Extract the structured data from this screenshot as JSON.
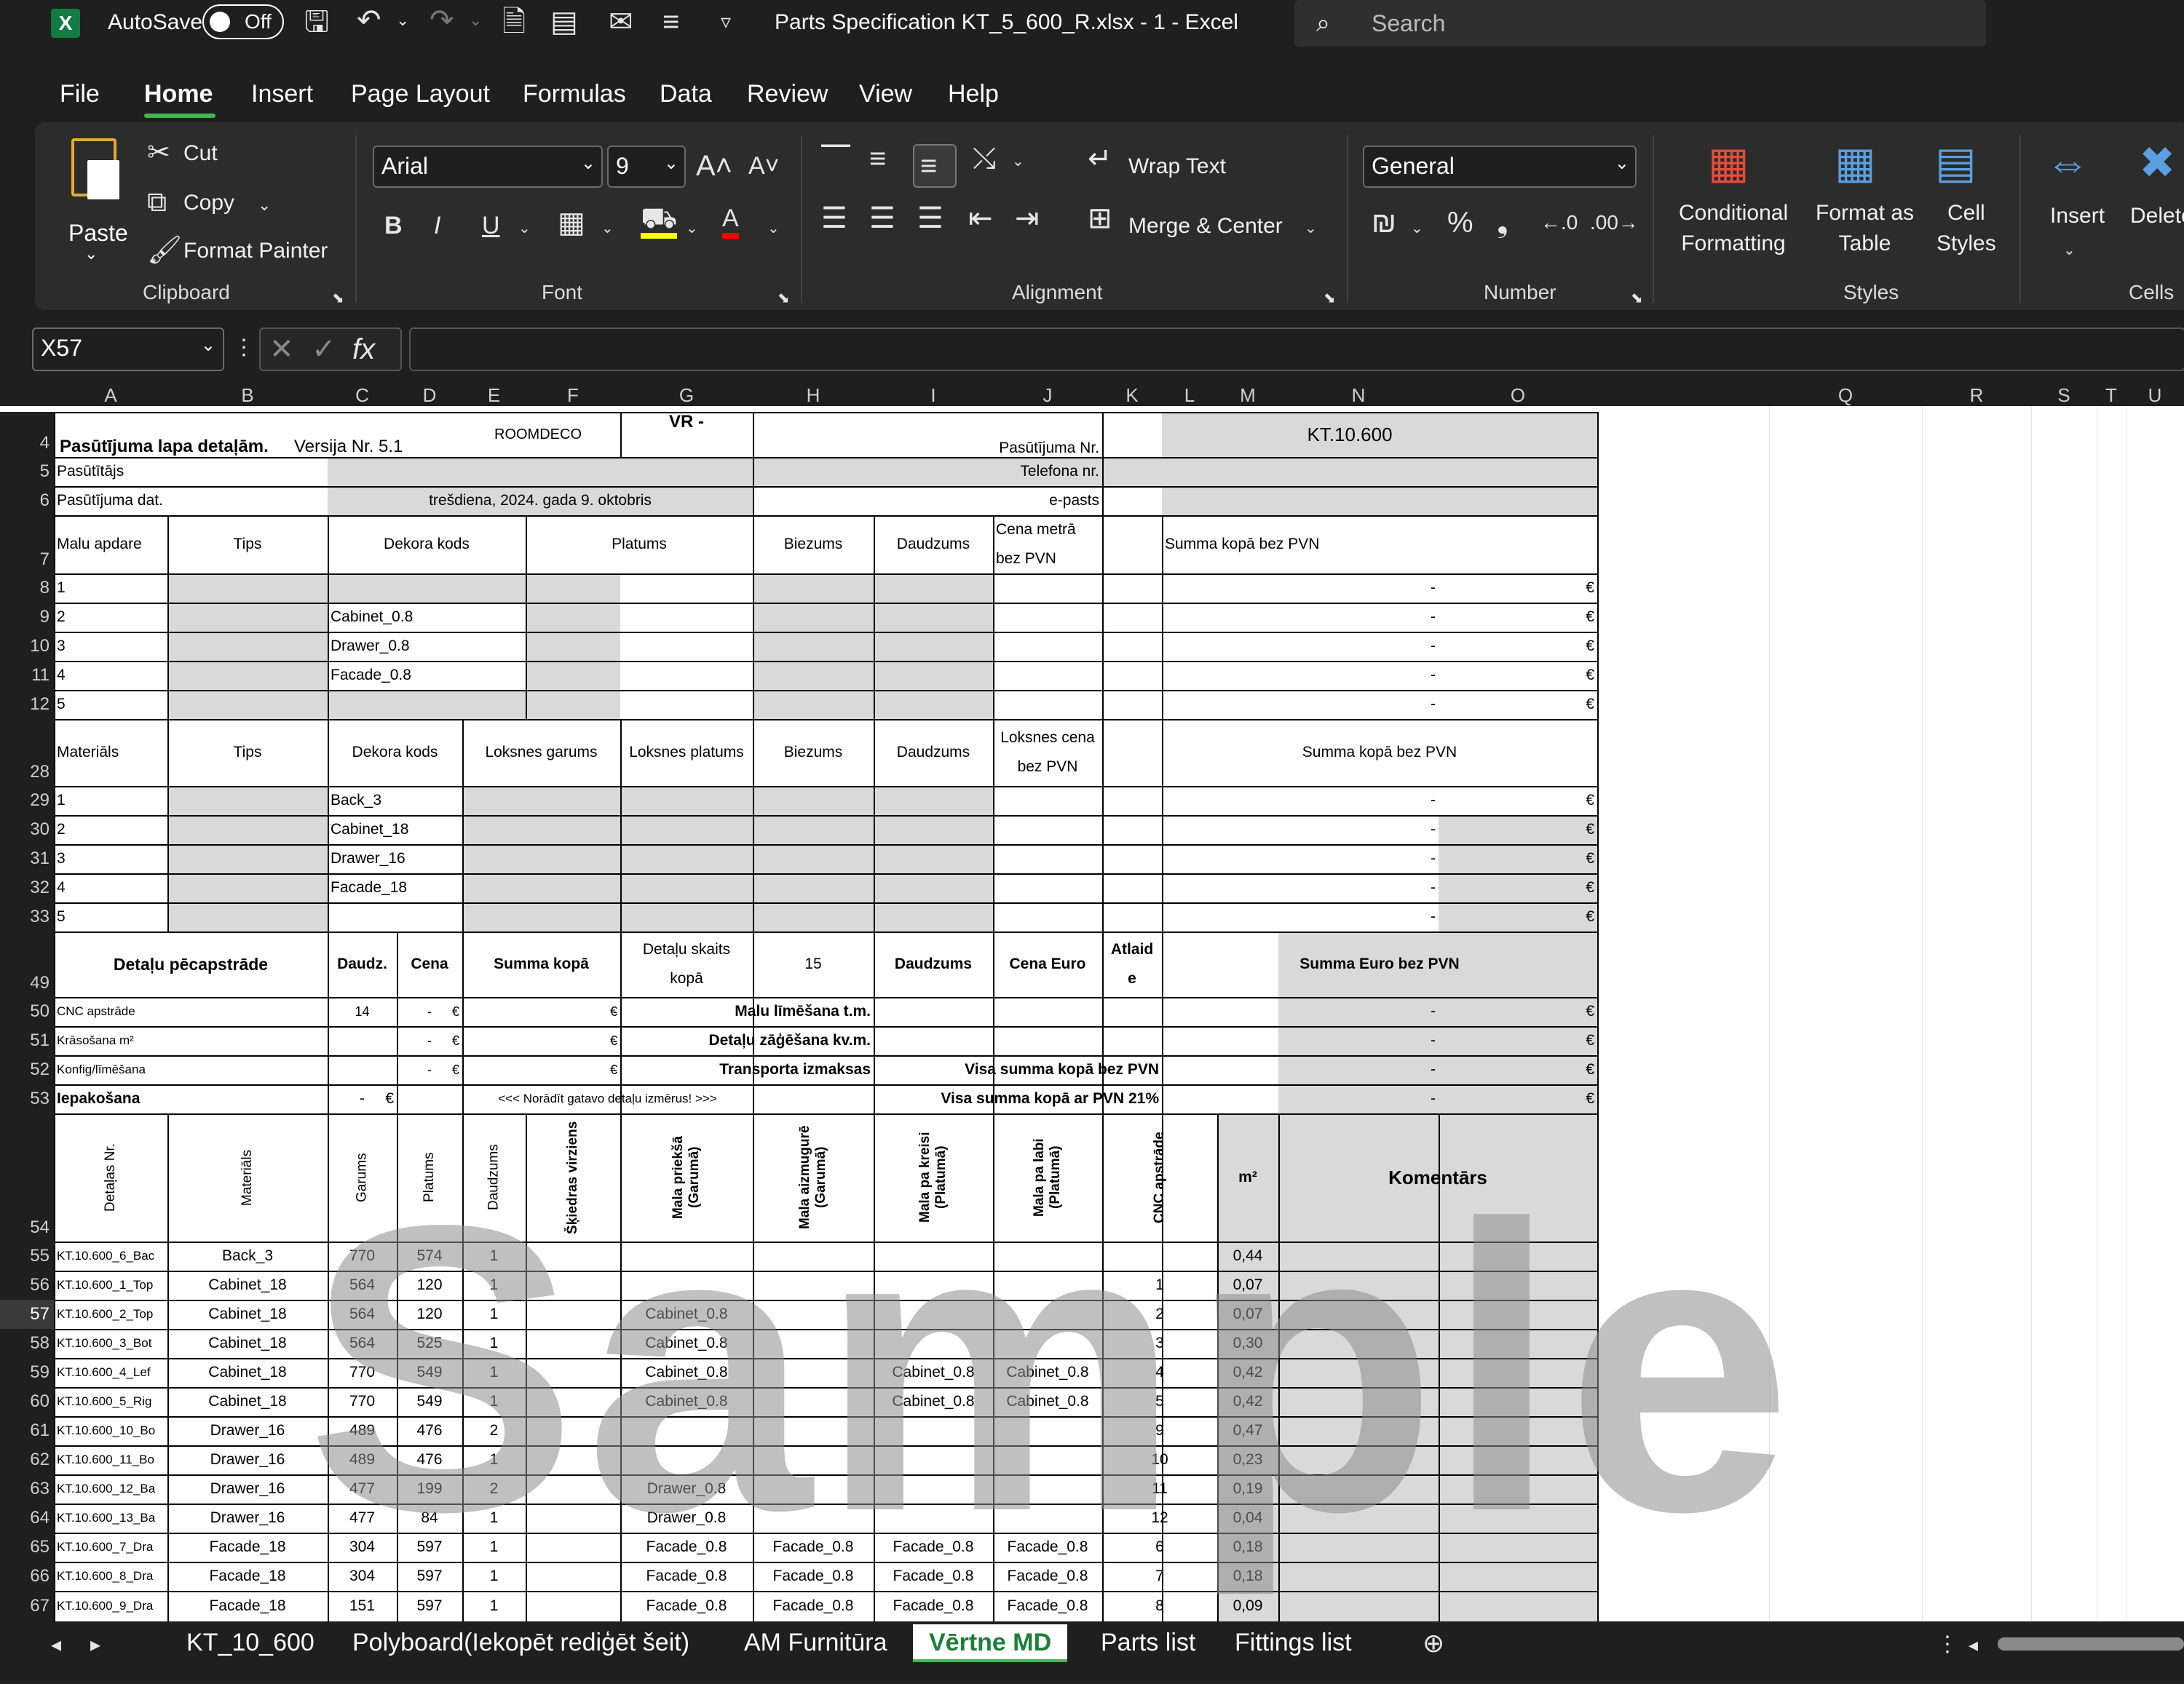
{
  "titlebar": {
    "autosave_label": "AutoSave",
    "autosave_state": "Off",
    "title": "Parts  Specification KT_5_600_R.xlsx  -  1  -  Excel",
    "search_placeholder": "Search"
  },
  "menu": [
    "File",
    "Home",
    "Insert",
    "Page Layout",
    "Formulas",
    "Data",
    "Review",
    "View",
    "Help"
  ],
  "ribbon": {
    "clipboard": {
      "paste": "Paste",
      "cut": "Cut",
      "copy": "Copy",
      "format_painter": "Format Painter",
      "group": "Clipboard"
    },
    "font": {
      "name": "Arial",
      "size": "9",
      "group": "Font"
    },
    "alignment": {
      "wrap": "Wrap Text",
      "merge": "Merge & Center",
      "group": "Alignment"
    },
    "number": {
      "format": "General",
      "group": "Number"
    },
    "styles": {
      "conditional": "Conditional\nFormatting",
      "format_table": "Format as\nTable",
      "cell_styles": "Cell\nStyles",
      "group": "Styles"
    },
    "cells": {
      "insert": "Insert",
      "delete": "Delete",
      "group": "Cells"
    }
  },
  "formula_bar": {
    "name_box": "X57",
    "formula": ""
  },
  "columns": [
    "A",
    "B",
    "C",
    "D",
    "E",
    "F",
    "G",
    "H",
    "I",
    "J",
    "K",
    "L",
    "M",
    "N",
    "O",
    "Q",
    "R",
    "S",
    "T",
    "U"
  ],
  "rows_numbers": [
    "4",
    "5",
    "6",
    "7",
    "8",
    "9",
    "10",
    "11",
    "12",
    "28",
    "29",
    "30",
    "31",
    "32",
    "33",
    "49",
    "50",
    "51",
    "52",
    "53",
    "54",
    "55",
    "56",
    "57",
    "58",
    "59",
    "60",
    "61",
    "62",
    "63",
    "64",
    "65",
    "66",
    "67"
  ],
  "header_block": {
    "title": "Pasūtījuma lapa  detaļām.",
    "version": "Versija Nr. 5.1",
    "logo": "ROOMDECO",
    "vr": "VR -",
    "order_label": "Pasūtījuma Nr.",
    "order_value": "KT.10.600",
    "customer": "Pasūtītājs",
    "phone": "Telefona nr.",
    "date_label": "Pasūtījuma dat.",
    "date_value": "trešdiena, 2024. gada 9. oktobris",
    "email": "e-pasts"
  },
  "edge_table": {
    "headers": [
      "Malu apdare",
      "Tips",
      "Dekora kods",
      "Platums",
      "Biezums",
      "Daudzums",
      "Cena metrā\nbez PVN",
      "Summa kopā bez PVN"
    ],
    "rows": [
      {
        "n": "1",
        "code": ""
      },
      {
        "n": "2",
        "code": "Cabinet_0.8"
      },
      {
        "n": "3",
        "code": "Drawer_0.8"
      },
      {
        "n": "4",
        "code": "Facade_0.8"
      },
      {
        "n": "5",
        "code": ""
      }
    ],
    "sum_cell": "-",
    "currency": "€"
  },
  "material_table": {
    "headers": [
      "Materiāls",
      "Tips",
      "Dekora kods",
      "Loksnes garums",
      "Loksnes platums",
      "Biezums",
      "Daudzums",
      "Loksnes cena\nbez PVN",
      "Summa kopā bez PVN"
    ],
    "rows": [
      {
        "n": "1",
        "code": "Back_3"
      },
      {
        "n": "2",
        "code": "Cabinet_18"
      },
      {
        "n": "3",
        "code": "Drawer_16"
      },
      {
        "n": "4",
        "code": "Facade_18"
      },
      {
        "n": "5",
        "code": ""
      }
    ]
  },
  "processing": {
    "title": "Detaļu pēcapstrāde",
    "h_qty": "Daudz.",
    "h_price": "Cena",
    "h_sum": "Summa kopā",
    "h_count": "Detaļu skaits\nkopā",
    "count_value": "15",
    "h_qty2": "Daudzums",
    "h_price_eur": "Cena Euro",
    "h_discount": "Atlaid\ne",
    "h_sum_eur": "Summa Euro bez PVN",
    "rows": [
      {
        "label": "CNC apstrāde",
        "qty": "14",
        "mid": "Malu līmēšana t.m."
      },
      {
        "label": "Krāsošana m²",
        "qty": "",
        "mid": "Detaļu zāģēšana  kv.m."
      },
      {
        "label": "Konfig/līmēšana",
        "qty": "",
        "mid": "Transporta izmaksas"
      }
    ],
    "packing": "Iepakošana",
    "note": "<<< Norādīt gatavo detaļu izmērus!  >>>",
    "total_no_vat": "Visa summa kopā bez PVN",
    "total_vat": "Visa summa kopā ar PVN 21%"
  },
  "parts_headers": [
    "Detaļas Nr.",
    "Materiāls",
    "Garums",
    "Platums",
    "Daudzums",
    "Šķiedras virziens",
    "Mala priekšā\n(Garumā)",
    "Mala aizmugurē\n(Garumā)",
    "Mala pa kreisi\n(Platumā)",
    "Mala pa labi\n(Platumā)",
    "CNC apstrāde",
    "m²",
    "Komentārs"
  ],
  "parts": [
    {
      "id": "KT.10.600_6_Bac",
      "mat": "Back_3",
      "l": "770",
      "w": "574",
      "q": "1",
      "front": "",
      "back": "",
      "left": "",
      "right": "",
      "cnc": "",
      "m2": "0,44"
    },
    {
      "id": "KT.10.600_1_Top",
      "mat": "Cabinet_18",
      "l": "564",
      "w": "120",
      "q": "1",
      "front": "",
      "back": "",
      "left": "",
      "right": "",
      "cnc": "1",
      "m2": "0,07"
    },
    {
      "id": "KT.10.600_2_Top",
      "mat": "Cabinet_18",
      "l": "564",
      "w": "120",
      "q": "1",
      "front": "Cabinet_0.8",
      "back": "",
      "left": "",
      "right": "",
      "cnc": "2",
      "m2": "0,07"
    },
    {
      "id": "KT.10.600_3_Bot",
      "mat": "Cabinet_18",
      "l": "564",
      "w": "525",
      "q": "1",
      "front": "Cabinet_0.8",
      "back": "",
      "left": "",
      "right": "",
      "cnc": "3",
      "m2": "0,30"
    },
    {
      "id": "KT.10.600_4_Lef",
      "mat": "Cabinet_18",
      "l": "770",
      "w": "549",
      "q": "1",
      "front": "Cabinet_0.8",
      "back": "",
      "left": "Cabinet_0.8",
      "right": "Cabinet_0.8",
      "cnc": "4",
      "m2": "0,42"
    },
    {
      "id": "KT.10.600_5_Rig",
      "mat": "Cabinet_18",
      "l": "770",
      "w": "549",
      "q": "1",
      "front": "Cabinet_0.8",
      "back": "",
      "left": "Cabinet_0.8",
      "right": "Cabinet_0.8",
      "cnc": "5",
      "m2": "0,42"
    },
    {
      "id": "KT.10.600_10_Bo",
      "mat": "Drawer_16",
      "l": "489",
      "w": "476",
      "q": "2",
      "front": "",
      "back": "",
      "left": "",
      "right": "",
      "cnc": "9",
      "m2": "0,47"
    },
    {
      "id": "KT.10.600_11_Bo",
      "mat": "Drawer_16",
      "l": "489",
      "w": "476",
      "q": "1",
      "front": "",
      "back": "",
      "left": "",
      "right": "",
      "cnc": "10",
      "m2": "0,23"
    },
    {
      "id": "KT.10.600_12_Ba",
      "mat": "Drawer_16",
      "l": "477",
      "w": "199",
      "q": "2",
      "front": "Drawer_0.8",
      "back": "",
      "left": "",
      "right": "",
      "cnc": "11",
      "m2": "0,19"
    },
    {
      "id": "KT.10.600_13_Ba",
      "mat": "Drawer_16",
      "l": "477",
      "w": "84",
      "q": "1",
      "front": "Drawer_0.8",
      "back": "",
      "left": "",
      "right": "",
      "cnc": "12",
      "m2": "0,04"
    },
    {
      "id": "KT.10.600_7_Dra",
      "mat": "Facade_18",
      "l": "304",
      "w": "597",
      "q": "1",
      "front": "Facade_0.8",
      "back": "Facade_0.8",
      "left": "Facade_0.8",
      "right": "Facade_0.8",
      "cnc": "6",
      "m2": "0,18"
    },
    {
      "id": "KT.10.600_8_Dra",
      "mat": "Facade_18",
      "l": "304",
      "w": "597",
      "q": "1",
      "front": "Facade_0.8",
      "back": "Facade_0.8",
      "left": "Facade_0.8",
      "right": "Facade_0.8",
      "cnc": "7",
      "m2": "0,18"
    },
    {
      "id": "KT.10.600_9_Dra",
      "mat": "Facade_18",
      "l": "151",
      "w": "597",
      "q": "1",
      "front": "Facade_0.8",
      "back": "Facade_0.8",
      "left": "Facade_0.8",
      "right": "Facade_0.8",
      "cnc": "8",
      "m2": "0,09"
    }
  ],
  "sheet_tabs": [
    "KT_10_600",
    "Polyboard(Iekopēt rediģēt šeit)",
    "AM Furnitūra",
    "Vērtne  MD",
    "Parts list",
    "Fittings list"
  ],
  "active_tab": "Vērtne  MD",
  "watermark": "Sample",
  "colors": {
    "active_tab": "#3fb950",
    "ribbon_bg": "#2c2c2c",
    "chrome_bg": "#1f1f1f",
    "shade": "#d9d9d9"
  }
}
